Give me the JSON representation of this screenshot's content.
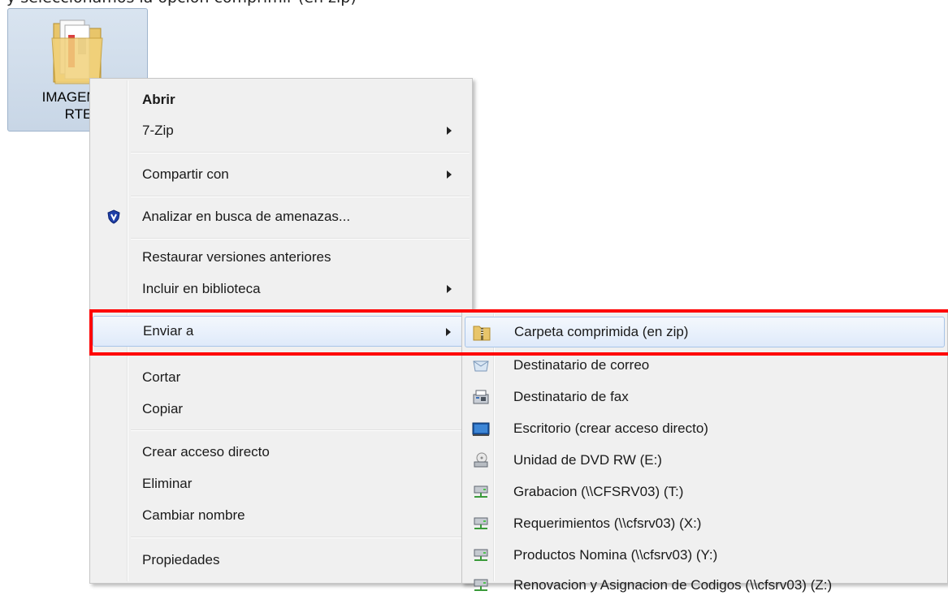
{
  "top_caption": "y seleccionamos la opción comprimir (en zip)",
  "folder": {
    "label_line1": "IMAGENES",
    "label_line2": "RTE",
    "icon": "folder-icon"
  },
  "context_menu": {
    "items": [
      {
        "label": "Abrir",
        "bold": true
      },
      {
        "label": "7-Zip",
        "submenu": true
      },
      {
        "label": "Compartir con",
        "submenu": true
      },
      {
        "label": "Analizar en busca de amenazas...",
        "icon": "shield-icon"
      },
      {
        "label": "Restaurar versiones anteriores"
      },
      {
        "label": "Incluir en biblioteca",
        "submenu": true
      },
      {
        "label": "Enviar a",
        "submenu": true,
        "highlighted": true
      },
      {
        "label": "Cortar"
      },
      {
        "label": "Copiar"
      },
      {
        "label": "Crear acceso directo"
      },
      {
        "label": "Eliminar"
      },
      {
        "label": "Cambiar nombre"
      },
      {
        "label": "Propiedades"
      }
    ]
  },
  "send_to_menu": {
    "items": [
      {
        "label": "Carpeta comprimida (en zip)",
        "icon": "zip-folder-icon",
        "highlighted": true
      },
      {
        "label": "Destinatario de correo",
        "icon": "mail-icon"
      },
      {
        "label": "Destinatario de fax",
        "icon": "fax-icon"
      },
      {
        "label": "Escritorio (crear acceso directo)",
        "icon": "desktop-icon"
      },
      {
        "label": "Unidad de DVD RW (E:)",
        "icon": "dvd-drive-icon"
      },
      {
        "label": "Grabacion (\\\\CFSRV03) (T:)",
        "icon": "network-drive-icon"
      },
      {
        "label": "Requerimientos (\\\\cfsrv03) (X:)",
        "icon": "network-drive-icon"
      },
      {
        "label": "Productos Nomina (\\\\cfsrv03) (Y:)",
        "icon": "network-drive-icon"
      },
      {
        "label": "Renovacion y Asignacion de Codigos (\\\\cfsrv03) (Z:)",
        "icon": "network-drive-icon"
      }
    ]
  },
  "colors": {
    "annotation": "#ff0000",
    "highlight_border": "#a8c4e8",
    "menu_background": "#f0f0f0"
  }
}
